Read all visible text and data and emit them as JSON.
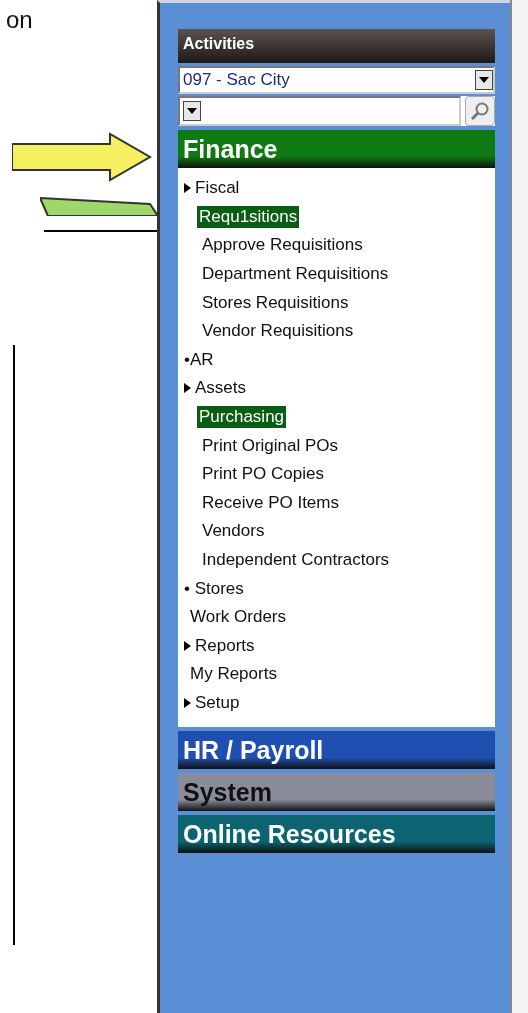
{
  "page_fragment": "on",
  "panel": {
    "title": "Activities",
    "district_select": {
      "value": "097 - Sac City"
    },
    "modules": [
      {
        "label": "Finance",
        "color": "#0f7a12",
        "items": [
          {
            "kind": "arrow",
            "label": "Fiscal"
          },
          {
            "kind": "section",
            "label": "Requ1sitions",
            "selected": true,
            "children": [
              {
                "label": "Approve Requisitions"
              },
              {
                "label": "Department Requisitions"
              },
              {
                "label": "Stores Requisitions"
              },
              {
                "label": "Vendor  Requisitions"
              }
            ]
          },
          {
            "kind": "bullet",
            "label": "•AR"
          },
          {
            "kind": "arrow",
            "label": "Assets"
          },
          {
            "kind": "section",
            "label": "Purchasing",
            "selected": true,
            "children": [
              {
                "label": "Print Original POs"
              },
              {
                "label": "Print PO Copies"
              },
              {
                "label": "Receive PO Items"
              },
              {
                "label": "Vendors"
              },
              {
                "label": "Independent Contractors"
              }
            ]
          },
          {
            "kind": "bullet",
            "label": "• Stores"
          },
          {
            "kind": "plain",
            "label": "Work Orders"
          },
          {
            "kind": "arrow",
            "label": "Reports"
          },
          {
            "kind": "plain",
            "label": "My Reports"
          },
          {
            "kind": "arrow",
            "label": "Setup"
          }
        ]
      },
      {
        "label": "HR / Payroll",
        "color": "#1f4fb0"
      },
      {
        "label": "System",
        "color": "#8a8c99"
      },
      {
        "label": "Online Resources",
        "color": "#0b6470"
      }
    ]
  }
}
